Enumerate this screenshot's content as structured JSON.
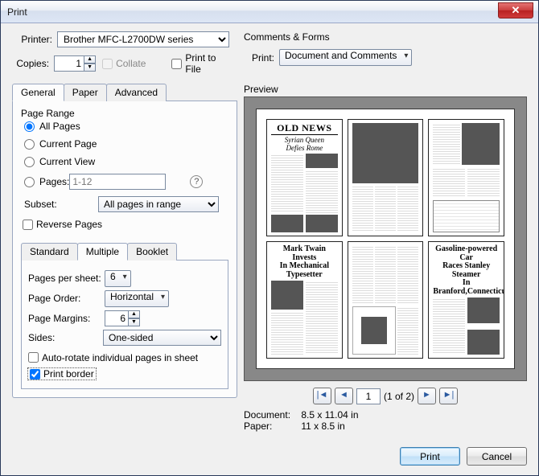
{
  "window": {
    "title": "Print"
  },
  "printer": {
    "label": "Printer:",
    "selected": "Brother MFC-L2700DW series",
    "copies_label": "Copies:",
    "copies": "1",
    "collate": "Collate",
    "print_to_file": "Print to File"
  },
  "comments_forms": {
    "group": "Comments & Forms",
    "print_label": "Print:",
    "selected": "Document and Comments"
  },
  "tabs": {
    "general": "General",
    "paper": "Paper",
    "advanced": "Advanced"
  },
  "page_range": {
    "group": "Page Range",
    "all": "All Pages",
    "current_page": "Current Page",
    "current_view": "Current View",
    "pages": "Pages:",
    "pages_placeholder": "1-12",
    "subset_label": "Subset:",
    "subset_value": "All pages in range",
    "reverse": "Reverse Pages"
  },
  "subtabs": {
    "standard": "Standard",
    "multiple": "Multiple",
    "booklet": "Booklet"
  },
  "multiple": {
    "pages_per_sheet_label": "Pages per sheet:",
    "pages_per_sheet": "6",
    "page_order_label": "Page Order:",
    "page_order": "Horizontal",
    "page_margins_label": "Page Margins:",
    "page_margins": "6",
    "sides_label": "Sides:",
    "sides": "One-sided",
    "auto_rotate": "Auto-rotate individual pages in sheet",
    "print_border": "Print border"
  },
  "preview": {
    "label": "Preview",
    "page": "1",
    "page_of": "(1 of 2)",
    "doc_label": "Document:",
    "doc_size": "8.5 x 11.04 in",
    "paper_label": "Paper:",
    "paper_size": "11 x 8.5 in",
    "pages": {
      "p1_mast": "OLD NEWS",
      "p1_h1": "Syrian Queen",
      "p1_h2": "Defies Rome",
      "p4_h1": "Mark Twain Invests",
      "p4_h2": "In Mechanical Typesetter",
      "p6_h1": "Gasoline-powered Car",
      "p6_h2": "Races Stanley Steamer",
      "p6_h3": "In Branford,Connecticut"
    }
  },
  "buttons": {
    "print": "Print",
    "cancel": "Cancel"
  }
}
